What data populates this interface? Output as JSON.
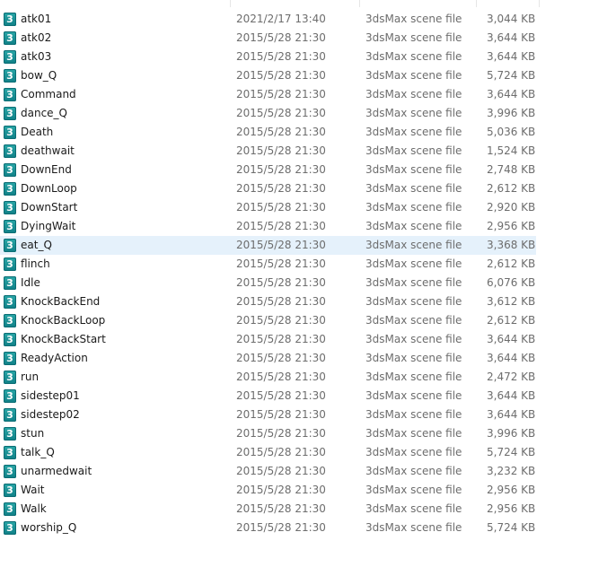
{
  "files": [
    {
      "name": "atk01",
      "date": "2021/2/17 13:40",
      "type": "3dsMax scene file",
      "size": "3,044 KB"
    },
    {
      "name": "atk02",
      "date": "2015/5/28 21:30",
      "type": "3dsMax scene file",
      "size": "3,644 KB"
    },
    {
      "name": "atk03",
      "date": "2015/5/28 21:30",
      "type": "3dsMax scene file",
      "size": "3,644 KB"
    },
    {
      "name": "bow_Q",
      "date": "2015/5/28 21:30",
      "type": "3dsMax scene file",
      "size": "5,724 KB"
    },
    {
      "name": "Command",
      "date": "2015/5/28 21:30",
      "type": "3dsMax scene file",
      "size": "3,644 KB"
    },
    {
      "name": "dance_Q",
      "date": "2015/5/28 21:30",
      "type": "3dsMax scene file",
      "size": "3,996 KB"
    },
    {
      "name": "Death",
      "date": "2015/5/28 21:30",
      "type": "3dsMax scene file",
      "size": "5,036 KB"
    },
    {
      "name": "deathwait",
      "date": "2015/5/28 21:30",
      "type": "3dsMax scene file",
      "size": "1,524 KB"
    },
    {
      "name": "DownEnd",
      "date": "2015/5/28 21:30",
      "type": "3dsMax scene file",
      "size": "2,748 KB"
    },
    {
      "name": "DownLoop",
      "date": "2015/5/28 21:30",
      "type": "3dsMax scene file",
      "size": "2,612 KB"
    },
    {
      "name": "DownStart",
      "date": "2015/5/28 21:30",
      "type": "3dsMax scene file",
      "size": "2,920 KB"
    },
    {
      "name": "DyingWait",
      "date": "2015/5/28 21:30",
      "type": "3dsMax scene file",
      "size": "2,956 KB"
    },
    {
      "name": "eat_Q",
      "date": "2015/5/28 21:30",
      "type": "3dsMax scene file",
      "size": "3,368 KB"
    },
    {
      "name": "flinch",
      "date": "2015/5/28 21:30",
      "type": "3dsMax scene file",
      "size": "2,612 KB"
    },
    {
      "name": "Idle",
      "date": "2015/5/28 21:30",
      "type": "3dsMax scene file",
      "size": "6,076 KB"
    },
    {
      "name": "KnockBackEnd",
      "date": "2015/5/28 21:30",
      "type": "3dsMax scene file",
      "size": "3,612 KB"
    },
    {
      "name": "KnockBackLoop",
      "date": "2015/5/28 21:30",
      "type": "3dsMax scene file",
      "size": "2,612 KB"
    },
    {
      "name": "KnockBackStart",
      "date": "2015/5/28 21:30",
      "type": "3dsMax scene file",
      "size": "3,644 KB"
    },
    {
      "name": "ReadyAction",
      "date": "2015/5/28 21:30",
      "type": "3dsMax scene file",
      "size": "3,644 KB"
    },
    {
      "name": "run",
      "date": "2015/5/28 21:30",
      "type": "3dsMax scene file",
      "size": "2,472 KB"
    },
    {
      "name": "sidestep01",
      "date": "2015/5/28 21:30",
      "type": "3dsMax scene file",
      "size": "3,644 KB"
    },
    {
      "name": "sidestep02",
      "date": "2015/5/28 21:30",
      "type": "3dsMax scene file",
      "size": "3,644 KB"
    },
    {
      "name": "stun",
      "date": "2015/5/28 21:30",
      "type": "3dsMax scene file",
      "size": "3,996 KB"
    },
    {
      "name": "talk_Q",
      "date": "2015/5/28 21:30",
      "type": "3dsMax scene file",
      "size": "5,724 KB"
    },
    {
      "name": "unarmedwait",
      "date": "2015/5/28 21:30",
      "type": "3dsMax scene file",
      "size": "3,232 KB"
    },
    {
      "name": "Wait",
      "date": "2015/5/28 21:30",
      "type": "3dsMax scene file",
      "size": "2,956 KB"
    },
    {
      "name": "Walk",
      "date": "2015/5/28 21:30",
      "type": "3dsMax scene file",
      "size": "2,956 KB"
    },
    {
      "name": "worship_Q",
      "date": "2015/5/28 21:30",
      "type": "3dsMax scene file",
      "size": "5,724 KB"
    }
  ],
  "selected_index": 12,
  "file_icon": "3ds-max-scene-icon",
  "colors": {
    "selection": "#e5f1fb",
    "icon": "#1a8f96"
  }
}
